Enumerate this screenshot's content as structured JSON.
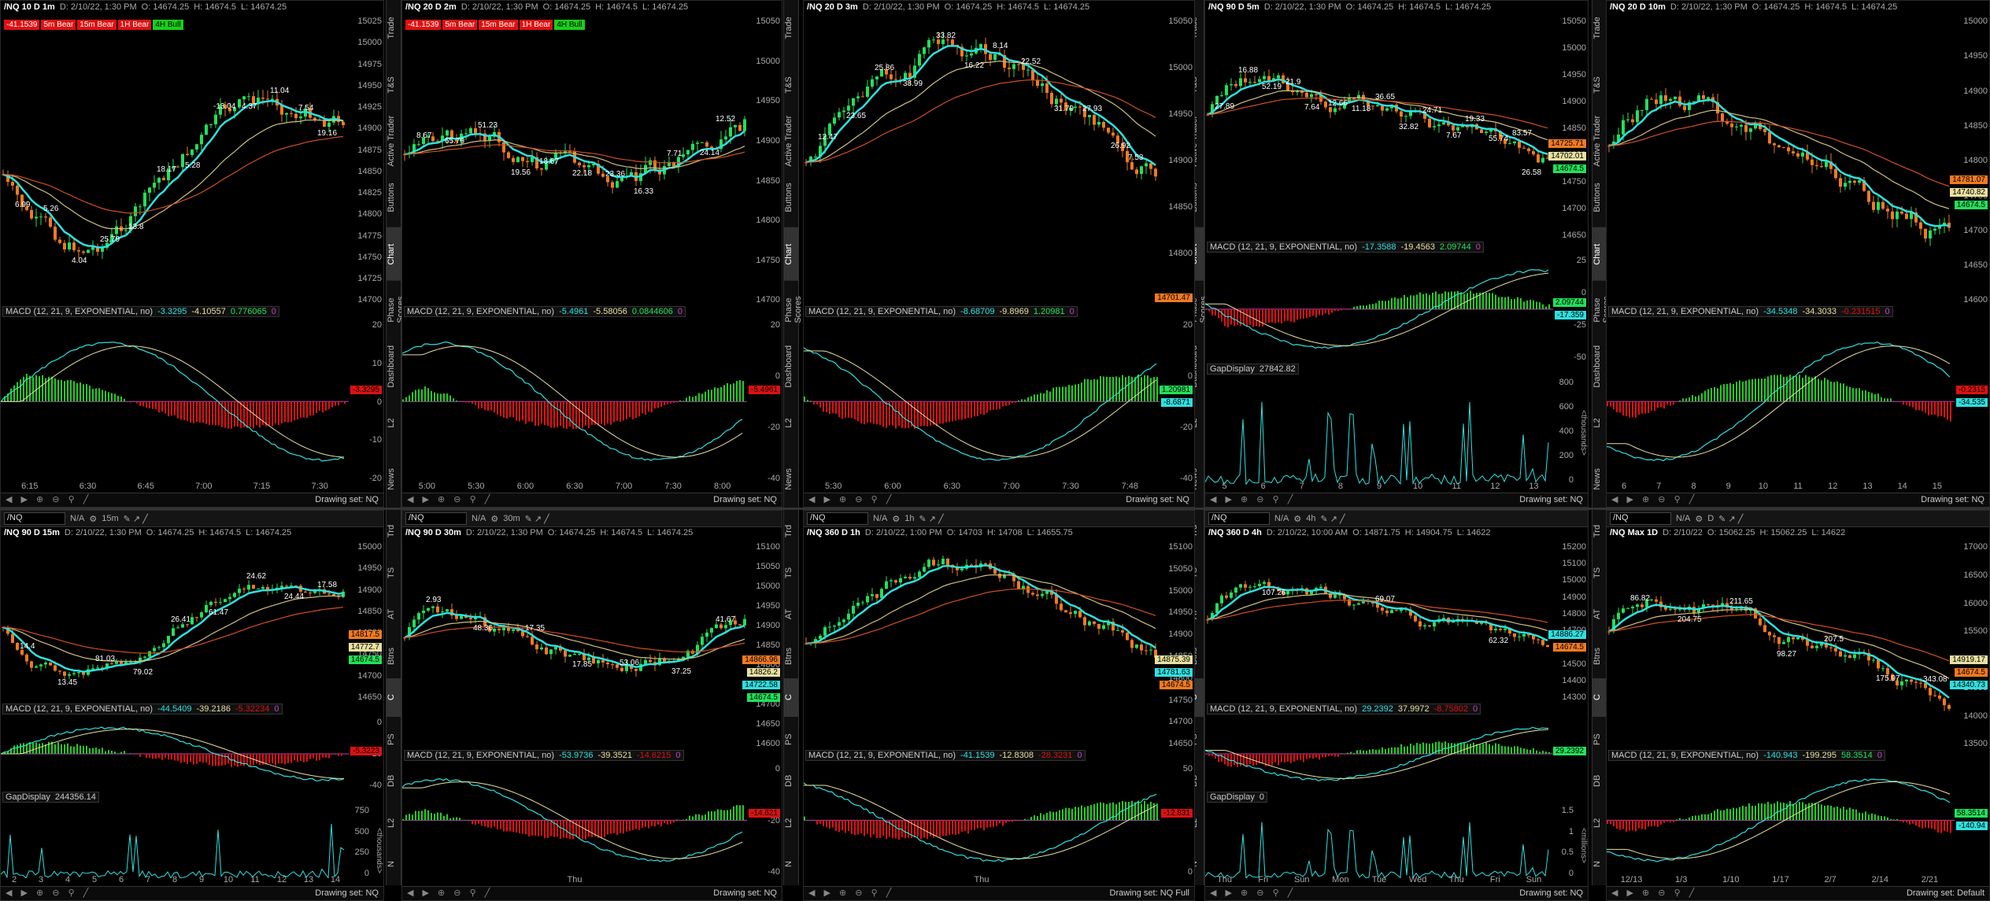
{
  "colors": {
    "up": "#22e05a",
    "down": "#f07a20",
    "cyan": "#2ee0e0",
    "ema_slow": "#d0c080",
    "ema_red": "#d05020",
    "hist_pos": "#22cc22",
    "hist_neg": "#dd1111",
    "volume": "#1a4a80"
  },
  "sidebar_top": {
    "items": [
      "Trade",
      "T&S",
      "Active Trader",
      "Buttons",
      "Chart",
      "Phase Scores",
      "Dashboard",
      "L2",
      "News"
    ],
    "active": "Chart"
  },
  "sidebar_bottom": {
    "items": [
      "Trd",
      "TS",
      "AT",
      "Btns",
      "C",
      "PS",
      "DB",
      "L2",
      "N"
    ],
    "active": "C"
  },
  "top_panes": [
    {
      "id": "p1",
      "symbol": "/NQ 10 D 1m",
      "date": "D: 2/10/22, 1:30 PM",
      "open": "O: 14674.25",
      "high": "H: 14674.5",
      "low": "L: 14674.25",
      "badges": [
        {
          "t": "-41.1539",
          "c": "red"
        },
        {
          "t": "5m Bear",
          "c": "red"
        },
        {
          "t": "15m Bear",
          "c": "red"
        },
        {
          "t": "1H Bear",
          "c": "red"
        },
        {
          "t": "4H Bull",
          "c": "green"
        }
      ],
      "price_ticks": [
        "15025",
        "15000",
        "14975",
        "14950",
        "14925",
        "14900",
        "14875",
        "14850",
        "14825",
        "14800",
        "14775",
        "14750",
        "14725",
        "14700"
      ],
      "macd": {
        "label": "MACD (12, 21, 9, EXPONENTIAL, no)",
        "v1": "-3.3295",
        "v2": "-4.10557",
        "v3": "0.776065",
        "v4": "0"
      },
      "macd_ticks": [
        "20",
        "10",
        "0",
        "-10",
        "-20"
      ],
      "macd_pill": "-3.3295",
      "time_ticks": [
        "6:15",
        "6:30",
        "6:45",
        "7:00",
        "7:15",
        "7:30"
      ],
      "annotations": [
        "6.99",
        "5.26",
        "4.04",
        "25.79",
        "13.8",
        "18.17",
        "5.28",
        "-13.04",
        "4.37",
        "11.04",
        "7.54",
        "19.16"
      ],
      "drawing": "Drawing set: NQ"
    },
    {
      "id": "p2",
      "symbol": "/NQ 20 D 2m",
      "date": "D: 2/10/22, 1:30 PM",
      "open": "O: 14674.25",
      "high": "H: 14674.5",
      "low": "L: 14674.25",
      "badges": [
        {
          "t": "-41.1539",
          "c": "red"
        },
        {
          "t": "5m Bear",
          "c": "red"
        },
        {
          "t": "15m Bear",
          "c": "red"
        },
        {
          "t": "1H Bear",
          "c": "red"
        },
        {
          "t": "4H Bull",
          "c": "green"
        }
      ],
      "price_ticks": [
        "15050",
        "15000",
        "14950",
        "14900",
        "14850",
        "14800",
        "14750",
        "14700"
      ],
      "macd": {
        "label": "MACD (12, 21, 9, EXPONENTIAL, no)",
        "v1": "-5.4961",
        "v2": "-5.58056",
        "v3": "0.0844606",
        "v4": "0"
      },
      "macd_ticks": [
        "20",
        "0",
        "-20",
        "-40"
      ],
      "macd_pill": "-5.4961",
      "time_ticks": [
        "5:00",
        "5:30",
        "6:00",
        "6:30",
        "7:00",
        "7:30",
        "8:00"
      ],
      "annotations": [
        "8.67",
        "65.79",
        "51.23",
        "19.56",
        "18.67",
        "22.18",
        "23.36",
        "16.33",
        "7.71",
        "24.14",
        "12.52"
      ],
      "drawing": "Drawing set: NQ"
    },
    {
      "id": "p3",
      "symbol": "/NQ 20 D 3m",
      "date": "D: 2/10/22, 1:30 PM",
      "open": "O: 14674.25",
      "high": "H: 14674.5",
      "low": "L: 14674.25",
      "badges": [],
      "price_ticks": [
        "15050",
        "15000",
        "14950",
        "14900",
        "14850",
        "14800",
        "14750"
      ],
      "price_pill": "14701.47",
      "macd": {
        "label": "MACD (12, 21, 9, EXPONENTIAL, no)",
        "v1": "-8.68709",
        "v2": "-9.8969",
        "v3": "1.20981",
        "v4": "0"
      },
      "macd_ticks": [
        "20",
        "0",
        "-20",
        "-40"
      ],
      "macd_pill": "1.20981",
      "macd_pill2": "-8.6871",
      "time_ticks": [
        "5:30",
        "6:00",
        "6:30",
        "7:00",
        "7:30",
        "7:48"
      ],
      "annotations": [
        "12.47",
        "23.65",
        "25.86",
        "38.99",
        "33.82",
        "16.22",
        "8.14",
        "22.52",
        "31.79",
        "27.93",
        "26.92",
        "7.53"
      ],
      "drawing": "Drawing set: NQ"
    },
    {
      "id": "p4",
      "symbol": "/NQ 90 D 5m",
      "date": "D: 2/10/22, 1:30 PM",
      "open": "O: 14674.25",
      "high": "H: 14674.5",
      "low": "L: 14674.25",
      "badges": [],
      "price_ticks": [
        "15050",
        "15000",
        "14950",
        "14900",
        "14850",
        "14800",
        "14750",
        "14700",
        "14650"
      ],
      "price_pills": [
        {
          "t": "14725.71",
          "c": "#f07a20"
        },
        {
          "t": "14702.01",
          "c": "#e8e0a0"
        },
        {
          "t": "14674.5",
          "c": "#22e05a"
        }
      ],
      "macd": {
        "label": "MACD (12, 21, 9, EXPONENTIAL, no)",
        "v1": "-17.3588",
        "v2": "-19.4563",
        "v3": "2.09744",
        "v4": "0"
      },
      "macd_ticks": [
        "25",
        "0",
        "-25",
        "-50"
      ],
      "macd_pill": "2.09744",
      "macd_pill2": "-17.359",
      "gap": {
        "label": "GapDisplay",
        "value": "27842.82",
        "ticks": [
          "800",
          "600",
          "400",
          "200",
          "0"
        ],
        "unit": "<thousands>"
      },
      "time_ticks": [
        "5",
        "6",
        "7",
        "8",
        "9",
        "10",
        "11",
        "12",
        "13"
      ],
      "annotations": [
        "27.89",
        "16.88",
        "52.19",
        "21.9",
        "7.64",
        "12.66",
        "11.18",
        "36.65",
        "32.82",
        "24.71",
        "7.67",
        "19.33",
        "55.74",
        "83.57",
        "26.58"
      ],
      "drawing": "Drawing set: NQ"
    },
    {
      "id": "p5",
      "symbol": "/NQ 20 D 10m",
      "date": "D: 2/10/22, 1:30 PM",
      "open": "O: 14674.25",
      "high": "H: 14674.5",
      "low": "L: 14674.25",
      "badges": [],
      "price_ticks": [
        "15000",
        "14950",
        "14900",
        "14850",
        "14800",
        "14750",
        "14700",
        "14650",
        "14600"
      ],
      "price_pills": [
        {
          "t": "14781.07",
          "c": "#f07a20"
        },
        {
          "t": "14740.82",
          "c": "#e8e0a0"
        },
        {
          "t": "14674.5",
          "c": "#22e05a"
        }
      ],
      "macd": {
        "label": "MACD (12, 21, 9, EXPONENTIAL, no)",
        "v1": "-34.5348",
        "v2": "-34.3033",
        "v3": "-0.231515",
        "v4": "0"
      },
      "macd_ticks": [],
      "macd_pill": "-0.2315",
      "macd_pill2": "-34.535",
      "time_ticks": [
        "6",
        "7",
        "8",
        "9",
        "10",
        "11",
        "12",
        "13",
        "14",
        "15"
      ],
      "annotations": [],
      "drawing": "Drawing set: NQ"
    }
  ],
  "bottom_panes": [
    {
      "id": "b1",
      "symbol": "/NQ 90 D 15m",
      "toolbar_sym": "/NQ",
      "toolbar_tf": "15m",
      "date": "D: 2/10/22, 1:30 PM",
      "open": "O: 14674.25",
      "high": "H: 14674.5",
      "low": "L: 14674.25",
      "price_ticks": [
        "15000",
        "14950",
        "14900",
        "14850",
        "14800",
        "14750",
        "14700",
        "14650"
      ],
      "price_pills": [
        {
          "t": "14817.5",
          "c": "#f07a20"
        },
        {
          "t": "14772.7",
          "c": "#e8e0a0"
        },
        {
          "t": "14674.5",
          "c": "#22e05a"
        }
      ],
      "macd": {
        "label": "MACD (12, 21, 9, EXPONENTIAL, no)",
        "v1": "-44.5409",
        "v2": "-39.2186",
        "v3": "-5.32234",
        "v4": "0"
      },
      "macd_ticks": [
        "0",
        "-20",
        "-40"
      ],
      "macd_pill": "-5.3223",
      "gap": {
        "label": "GapDisplay",
        "value": "244356.14",
        "ticks": [
          "750",
          "500",
          "250",
          "0"
        ],
        "unit": "<thousands>"
      },
      "time_ticks": [
        "2",
        "3",
        "4",
        "5",
        "6",
        "7",
        "8",
        "9",
        "10",
        "11",
        "12",
        "13",
        "14"
      ],
      "annotations": [
        "14.4",
        "13.45",
        "81.03",
        "79.02",
        "26.41",
        "61.47",
        "24.62",
        "24.44",
        "17.58"
      ],
      "drawing": "Drawing set: NQ"
    },
    {
      "id": "b2",
      "symbol": "/NQ 90 D 30m",
      "toolbar_sym": "/NQ",
      "toolbar_tf": "30m",
      "date": "D: 2/10/22, 1:30 PM",
      "open": "O: 14674.25",
      "high": "H: 14674.5",
      "low": "L: 14674.25",
      "price_ticks": [
        "15100",
        "15050",
        "15000",
        "14950",
        "14900",
        "14850",
        "14800",
        "14750",
        "14700",
        "14650",
        "14600"
      ],
      "price_pills": [
        {
          "t": "14866.96",
          "c": "#f07a20"
        },
        {
          "t": "14826.2",
          "c": "#e8e0a0"
        },
        {
          "t": "14722.58",
          "c": "#2ee0e0"
        },
        {
          "t": "14674.5",
          "c": "#22e05a"
        }
      ],
      "macd": {
        "label": "MACD (12, 21, 9, EXPONENTIAL, no)",
        "v1": "-53.9736",
        "v2": "-39.3521",
        "v3": "-14.6215",
        "v4": "0"
      },
      "macd_ticks": [
        "0",
        "-20",
        "-40"
      ],
      "macd_pill": "-14.621",
      "time_ticks": [
        "Thu"
      ],
      "annotations": [
        "2.93",
        "48.36",
        "17.35",
        "17.85",
        "53.06",
        "37.25",
        "41.67"
      ],
      "drawing": "Drawing set: NQ"
    },
    {
      "id": "b3",
      "symbol": "/NQ 360 D 1h",
      "toolbar_sym": "/NQ",
      "toolbar_tf": "1h",
      "date": "D: 2/10/22, 1:00 PM",
      "open": "O: 14703",
      "high": "H: 14708",
      "low": "L: 14655.75",
      "price_ticks": [
        "15100",
        "15050",
        "15000",
        "14950",
        "14900",
        "14850",
        "14800",
        "14750",
        "14700",
        "14650"
      ],
      "price_pills": [
        {
          "t": "14875.39",
          "c": "#e8e0a0"
        },
        {
          "t": "14781.63",
          "c": "#2ee0e0"
        },
        {
          "t": "14674.5",
          "c": "#f07a20"
        }
      ],
      "macd": {
        "label": "MACD (12, 21, 9, EXPONENTIAL, no)",
        "v1": "-41.1539",
        "v2": "-12.8308",
        "v3": "-28.3231",
        "v4": "0"
      },
      "macd_ticks": [
        "50",
        "0"
      ],
      "macd_pill": "-12.831",
      "time_ticks": [
        "Thu"
      ],
      "annotations": [],
      "drawing": "Drawing set: NQ Full"
    },
    {
      "id": "b4",
      "symbol": "/NQ 360 D 4h",
      "toolbar_sym": "/NQ",
      "toolbar_tf": "4h",
      "date": "D: 2/10/22, 10:00 AM",
      "open": "O: 14871.75",
      "high": "H: 14904.75",
      "low": "L: 14622",
      "price_ticks": [
        "15200",
        "15100",
        "15000",
        "14900",
        "14800",
        "14700",
        "14600",
        "14500",
        "14400",
        "14300"
      ],
      "price_pills": [
        {
          "t": "14886.27",
          "c": "#2ee0e0"
        },
        {
          "t": "14674.5",
          "c": "#f07a20"
        }
      ],
      "macd": {
        "label": "MACD (12, 21, 9, EXPONENTIAL, no)",
        "v1": "29.2392",
        "v2": "37.9972",
        "v3": "-8.75802",
        "v4": "0"
      },
      "macd_ticks": [],
      "macd_pill": "29.2392",
      "gap": {
        "label": "GapDisplay",
        "value": "0",
        "ticks": [
          "1.5",
          "1",
          "0.5",
          "0"
        ],
        "unit": "<millions>"
      },
      "time_ticks": [
        "Thu",
        "Fri",
        "Sun",
        "Mon",
        "Tue",
        "Wed",
        "Thu",
        "Fri",
        "Sun"
      ],
      "annotations": [
        "107.26",
        "69.07",
        "62.32"
      ],
      "drawing": "Drawing set: NQ"
    },
    {
      "id": "b5",
      "symbol": "/NQ Max 1D",
      "toolbar_sym": "/NQ",
      "toolbar_tf": "D",
      "date": "D: 2/10/22",
      "open": "O: 15062.25",
      "high": "H: 15062.25",
      "low": "L: 14622",
      "price_ticks": [
        "17000",
        "16500",
        "16000",
        "15500",
        "15000",
        "14500",
        "14000",
        "13500"
      ],
      "price_pills": [
        {
          "t": "14919.17",
          "c": "#e8e0a0"
        },
        {
          "t": "14674.5",
          "c": "#f07a20"
        },
        {
          "t": "14340.73",
          "c": "#2ee0e0"
        }
      ],
      "macd": {
        "label": "MACD (12, 21, 9, EXPONENTIAL, no)",
        "v1": "-140.943",
        "v2": "-199.295",
        "v3": "58.3514",
        "v4": "0"
      },
      "macd_ticks": [],
      "macd_pill": "58.3514",
      "macd_pill2": "-140.94",
      "time_ticks": [
        "12/13",
        "1/3",
        "1/10",
        "1/17",
        "2/7",
        "2/14",
        "2/21"
      ],
      "annotations": [
        "86.82",
        "204.75",
        "211.65",
        "98.27",
        "207.5",
        "175.97",
        "343.08"
      ],
      "drawing": "Drawing set: Default"
    }
  ],
  "toolbar": {
    "na": "N/A",
    "na2": "N/A",
    "na3": "N/A"
  }
}
